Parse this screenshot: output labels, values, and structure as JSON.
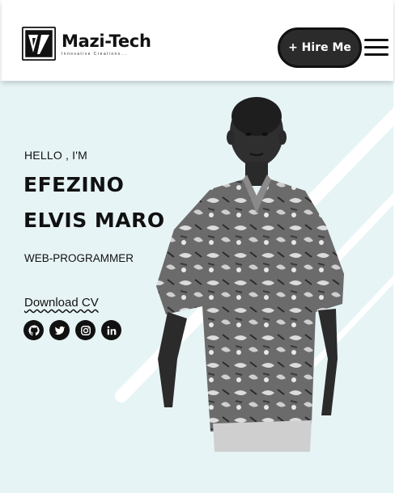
{
  "brand": {
    "name": "Mazi-Tech",
    "tagline": "Innovative Creations..."
  },
  "nav": {
    "hire_label": "+ Hire Me",
    "menu_icon": "hamburger-menu-icon"
  },
  "hero": {
    "greeting": "HELLO , I'M",
    "name_line1": "EFEZINO",
    "name_line2": "ELVIS MARO",
    "role": "WEB-PROGRAMMER",
    "cv_label": "Download CV",
    "socials": [
      "github-icon",
      "twitter-icon",
      "instagram-icon",
      "linkedin-icon"
    ]
  },
  "colors": {
    "hero_bg": "#e7f4f6",
    "accent_dark": "#111111",
    "button_bg": "#2b2b2b"
  }
}
